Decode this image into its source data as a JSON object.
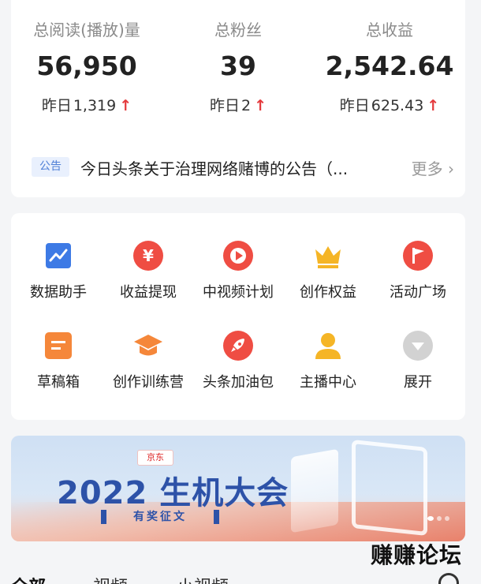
{
  "stats": [
    {
      "label": "总阅读(播放)量",
      "value": "56,950",
      "yesterday_label": "昨日",
      "yesterday_value": "1,319",
      "trend": "up"
    },
    {
      "label": "总粉丝",
      "value": "39",
      "yesterday_label": "昨日",
      "yesterday_value": "2",
      "trend": "up"
    },
    {
      "label": "总收益",
      "value": "2,542.64",
      "yesterday_label": "昨日",
      "yesterday_value": "625.43",
      "trend": "up"
    }
  ],
  "notice": {
    "badge": "公告",
    "text": "今日头条关于治理网络赌博的公告（...",
    "more": "更多"
  },
  "tools": [
    {
      "label": "数据助手",
      "icon": "data-chart-icon",
      "color": "#3d7ae5"
    },
    {
      "label": "收益提现",
      "icon": "yuan-icon",
      "color": "#ef4d43"
    },
    {
      "label": "中视频计划",
      "icon": "play-icon",
      "color": "#ef4d43"
    },
    {
      "label": "创作权益",
      "icon": "crown-icon",
      "color": "#f5b526"
    },
    {
      "label": "活动广场",
      "icon": "flag-icon",
      "color": "#ef4d43"
    },
    {
      "label": "草稿箱",
      "icon": "draft-icon",
      "color": "#f5873a"
    },
    {
      "label": "创作训练营",
      "icon": "graduation-cap-icon",
      "color": "#f5873a"
    },
    {
      "label": "头条加油包",
      "icon": "rocket-icon",
      "color": "#ef4d43"
    },
    {
      "label": "主播中心",
      "icon": "anchor-user-icon",
      "color": "#f5b526"
    },
    {
      "label": "展开",
      "icon": "expand-chevron-icon",
      "color": "#c8c8c8"
    }
  ],
  "banner": {
    "logo": "京东",
    "title": "2022 生机大会",
    "subtitle": "有奖征文"
  },
  "watermark": "赚赚论坛",
  "tabs": [
    "全部",
    "视频",
    "小视频"
  ],
  "colors": {
    "accent": "#e4393c",
    "brand_blue": "#2d52a8"
  }
}
